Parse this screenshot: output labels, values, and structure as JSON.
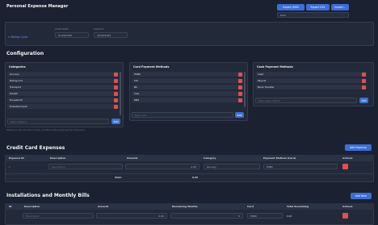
{
  "header": {
    "title": "Personal Expense Manager",
    "export_json": "Export JSON",
    "export_csv": "Export CSV",
    "import": "Import...",
    "theme_value": "Dark"
  },
  "cycle": {
    "link": "Billing Cycle",
    "start_label": "CYCLE FROM",
    "start_value": "01/09/2025",
    "end_label": "CYCLE TO",
    "end_value": "30/09/2025"
  },
  "config": {
    "title": "Configuration",
    "categories": {
      "title": "Categories",
      "items": [
        "Grocery",
        "Eating Out",
        "Transport",
        "Health",
        "Household",
        "Entertainment"
      ],
      "placeholder": "New category",
      "add": "Add"
    },
    "card_methods": {
      "title": "Card Payment Methods",
      "items": [
        "HSBC",
        "Citi",
        "BC",
        "Visa",
        "DBS"
      ],
      "placeholder": "New card",
      "add": "Add"
    },
    "cash_methods": {
      "title": "Cash Payment Methods",
      "items": [
        "Cash",
        "Paynet",
        "Bank Transfer"
      ],
      "placeholder": "New cash method",
      "add": "Add"
    },
    "note": "Deleting an item from this list does not affect existing expenses that reference it."
  },
  "credit": {
    "title": "Credit Card Expenses",
    "add": "Add Expense",
    "columns": [
      "Expense ID",
      "Description",
      "Amount",
      "Category",
      "Payment Method (Card)",
      "Actions"
    ],
    "row": {
      "id": "1",
      "desc": "Description",
      "amount": "0.00",
      "category": "Grocery",
      "method": "HSBC"
    },
    "total_label": "Total:",
    "total_value": "0.00"
  },
  "installments": {
    "title": "Installations and Monthly Bills",
    "add": "Add Item",
    "columns": [
      "ID",
      "Description",
      "Amount",
      "Remaining Months",
      "Card",
      "Total Remaining",
      "Actions"
    ],
    "row": {
      "desc": "Description",
      "amount": "0.00",
      "months": "0",
      "card": "HSBC",
      "remaining": "0.00"
    }
  }
}
